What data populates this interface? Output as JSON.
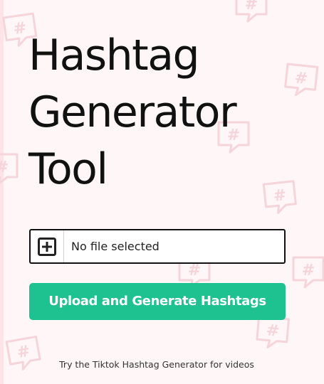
{
  "page": {
    "title_lines": [
      "Hashtag",
      "Generator",
      "Tool"
    ]
  },
  "upload": {
    "file_status": "No file selected",
    "button_label": "Upload and Generate Hashtags"
  },
  "footer": {
    "link_text": "Try the Tiktok Hashtag Generator for videos"
  },
  "theme": {
    "accent": "#1ec291",
    "background": "#fff6f7",
    "pattern_color": "#f9d9dd",
    "text": "#111111"
  },
  "icons": {
    "add_file": "plus-square-icon",
    "background_decoration": "hashtag-speech-bubble-icon"
  }
}
